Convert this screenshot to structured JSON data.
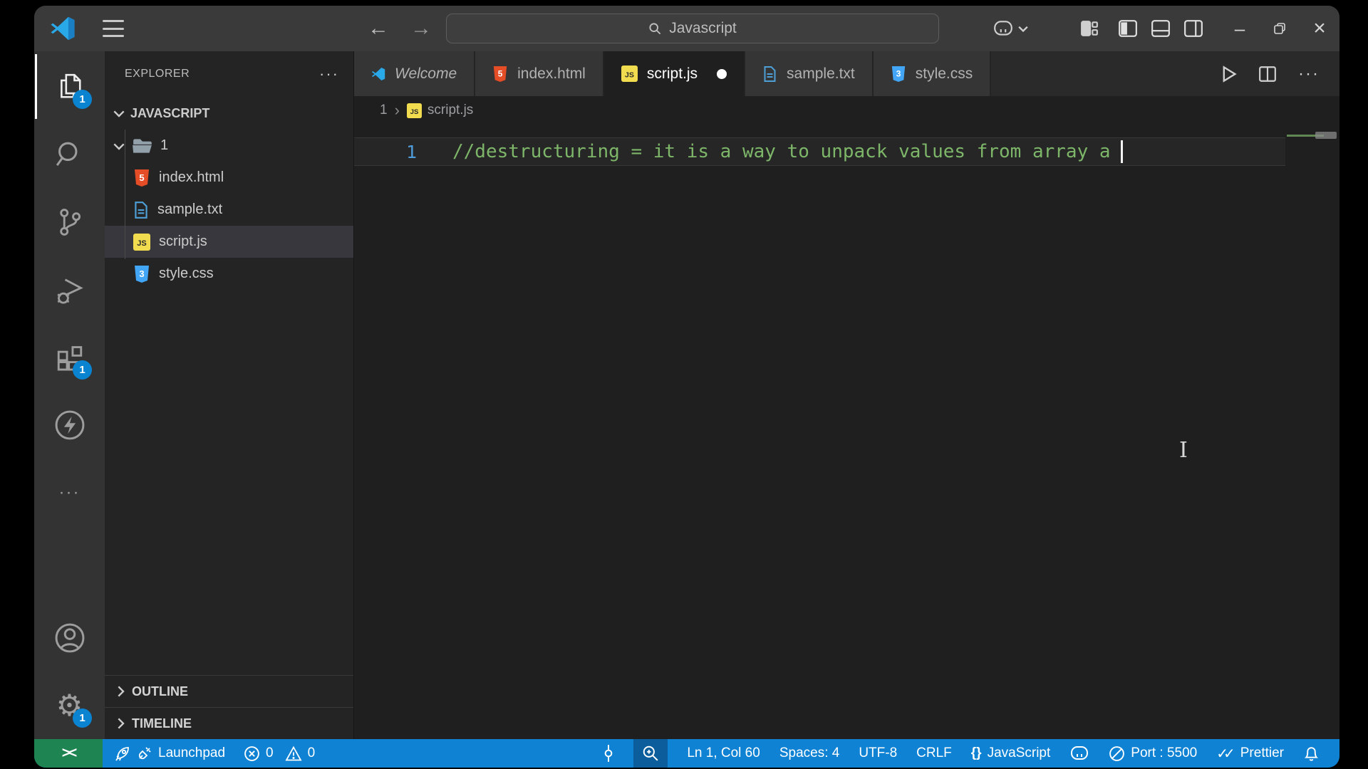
{
  "icons": {
    "back": "←",
    "forward": "→",
    "minimize": "–",
    "close": "×",
    "ellipsis": "···",
    "breadcrumb_separator": "›",
    "settings_gear": "⚙",
    "remote": "><",
    "braces": "{}",
    "checkmarks": "✓✓",
    "mouse_ibeam": "I"
  },
  "title_bar": {
    "search_value": "Javascript"
  },
  "activity_bar": {
    "explorer_badge": "1",
    "extensions_badge": "1",
    "settings_badge": "1"
  },
  "explorer": {
    "title": "EXPLORER",
    "section_label": "JAVASCRIPT",
    "folder_label": "1",
    "files": [
      {
        "name": "index.html"
      },
      {
        "name": "sample.txt"
      },
      {
        "name": "script.js"
      },
      {
        "name": "style.css"
      }
    ],
    "outline_label": "OUTLINE",
    "timeline_label": "TIMELINE"
  },
  "editor": {
    "tabs": [
      {
        "label": "Welcome"
      },
      {
        "label": "index.html"
      },
      {
        "label": "script.js"
      },
      {
        "label": "sample.txt"
      },
      {
        "label": "style.css"
      }
    ],
    "breadcrumb": {
      "folder": "1",
      "file": "script.js"
    },
    "line_number": "1",
    "code_line": "//destructuring = it is a way to unpack values from array a"
  },
  "status_bar": {
    "launchpad_label": "Launchpad",
    "errors": "0",
    "warnings": "0",
    "line_col": "Ln 1, Col 60",
    "spaces": "Spaces: 4",
    "encoding": "UTF-8",
    "eol": "CRLF",
    "language": "JavaScript",
    "port": "Port : 5500",
    "prettier_label": "Prettier"
  },
  "colors": {
    "status_blue": "#0f82d4",
    "remote_green": "#1e8452",
    "badge_blue": "#0a84d0",
    "comment_green": "#7db669",
    "js_yellow": "#f0dc4e",
    "html_orange": "#e44d26",
    "file_blue": "#4d9fd6"
  }
}
